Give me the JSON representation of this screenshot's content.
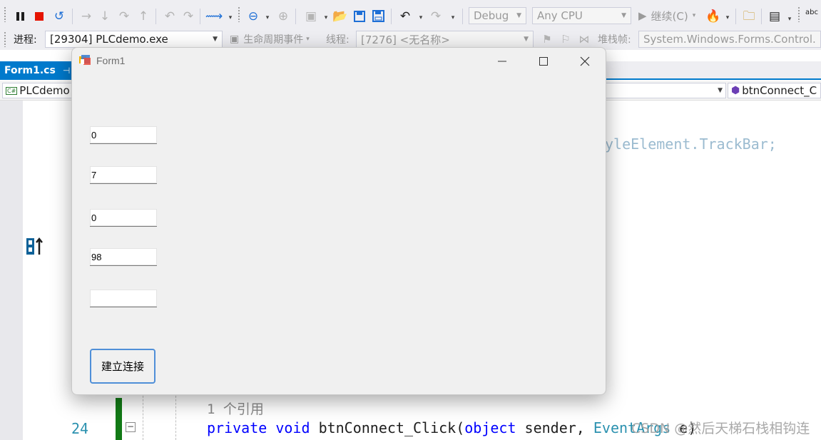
{
  "toolbar1": {
    "config_combo": "Debug",
    "platform_combo": "Any CPU",
    "continue_label": "继续(C)",
    "spell_text": "abc"
  },
  "toolbar2": {
    "process_label": "进程:",
    "process_value": "[29304] PLCdemo.exe",
    "lifecycle_label": "生命周期事件",
    "thread_label": "线程:",
    "thread_value": "[7276] <无名称>",
    "stack_label": "堆栈帧:",
    "stack_value": "System.Windows.Forms.Control.M"
  },
  "doc_tab": {
    "label": "Form1.cs",
    "pin": "⊣"
  },
  "navbar": {
    "project": "PLCdemo",
    "member": "btnConnect_C"
  },
  "code": {
    "faded_fragment": "yleElement.TrackBar;",
    "reference_hint": "1 个引用",
    "line_number": "24",
    "kw_private": "private",
    "kw_void": "void",
    "method": "btnConnect_Click(",
    "kw_object": "object",
    "sender": " sender, ",
    "type_eventargs": "EventArgs",
    "tail": " e)",
    "collapse": "−"
  },
  "form1": {
    "title": "Form1",
    "textboxes": [
      "0",
      "7",
      "0",
      "98",
      ""
    ],
    "connect_button": "建立连接"
  },
  "watermark": "CSDN @然后天梯石栈相钩连"
}
